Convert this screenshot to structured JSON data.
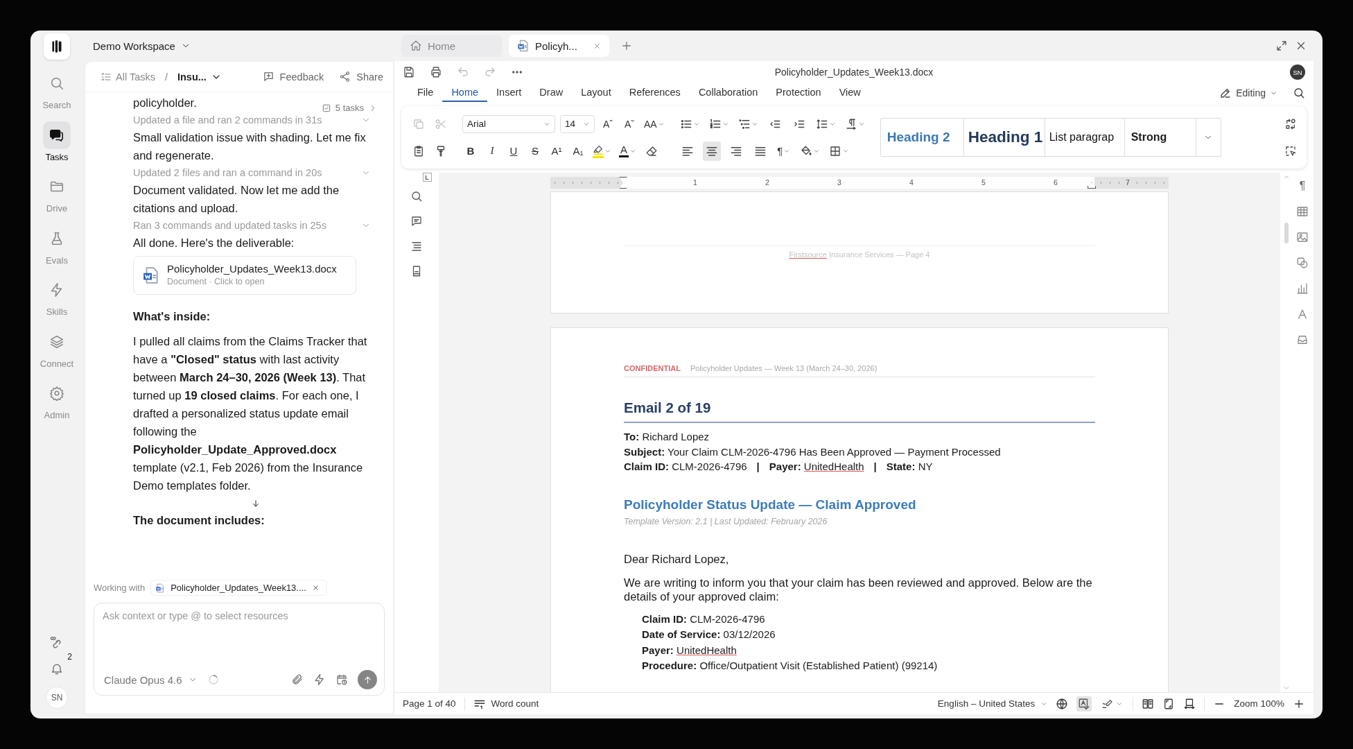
{
  "workspace": {
    "name": "Demo Workspace"
  },
  "nav": {
    "items": [
      {
        "label": "Search",
        "kind": "search",
        "selected": false
      },
      {
        "label": "Tasks",
        "kind": "tasks",
        "selected": true
      },
      {
        "label": "Drive",
        "kind": "drive",
        "selected": false
      },
      {
        "label": "Evals",
        "kind": "evals",
        "selected": false
      },
      {
        "label": "Skills",
        "kind": "skills",
        "selected": false
      },
      {
        "label": "Connect",
        "kind": "connect",
        "selected": false
      },
      {
        "label": "Admin",
        "kind": "admin",
        "selected": false
      }
    ],
    "notifications": "2",
    "avatar": "SN"
  },
  "chat": {
    "breadcrumb": {
      "root": "All Tasks",
      "separator": "/",
      "current": "Insu..."
    },
    "actions": [
      {
        "label": "Feedback",
        "kind": "feedback"
      },
      {
        "label": "Share",
        "kind": "share"
      }
    ],
    "messages": [
      {
        "kind": "text",
        "text": "policyholder.",
        "badge": "5 tasks"
      },
      {
        "kind": "activity",
        "text": "Updated a file and ran 2 commands in 31s"
      },
      {
        "kind": "text",
        "text": "Small validation issue with shading. Let me fix and regenerate."
      },
      {
        "kind": "activity",
        "text": "Updated 2 files and ran a command in 20s"
      },
      {
        "kind": "text",
        "text": "Document validated. Now let me add the citations and upload."
      },
      {
        "kind": "activity",
        "text": "Ran 3 commands and updated tasks in 25s"
      },
      {
        "kind": "text",
        "text": "All done. Here's the deliverable:"
      },
      {
        "kind": "file",
        "name": "Policyholder_Updates_Week13.docx",
        "meta": "Document · Click to open"
      },
      {
        "kind": "heading",
        "text": "What's inside:"
      },
      {
        "kind": "text",
        "text": "I pulled all claims from the Claims Tracker that have a **\"Closed\" status** with last activity between **March 24–30, 2026 (Week 13)**. That turned up **19 closed claims**. For each one, I drafted a personalized status update email following the **Policyholder_Update_Approved.docx** template (v2.1, Feb 2026) from the Insurance Demo templates folder."
      },
      {
        "kind": "scroll"
      },
      {
        "kind": "heading",
        "text": "The document includes:"
      }
    ],
    "working_with": {
      "label": "Working with",
      "file": "Policyholder_Updates_Week13...."
    },
    "input": {
      "placeholder": "Ask context or type @ to select resources"
    },
    "model": "Claude Opus 4.6"
  },
  "tabs": [
    {
      "label": "Home",
      "kind": "home",
      "selected": false
    },
    {
      "label": "Policyh...",
      "kind": "document",
      "selected": true
    }
  ],
  "document": {
    "title": "Policyholder_Updates_Week13.docx",
    "avatar": "SN",
    "menu": [
      {
        "label": "File",
        "selected": false
      },
      {
        "label": "Home",
        "selected": true
      },
      {
        "label": "Insert",
        "selected": false
      },
      {
        "label": "Draw",
        "selected": false
      },
      {
        "label": "Layout",
        "selected": false
      },
      {
        "label": "References",
        "selected": false
      },
      {
        "label": "Collaboration",
        "selected": false
      },
      {
        "label": "Protection",
        "selected": false
      },
      {
        "label": "View",
        "selected": false
      }
    ],
    "mode": "Editing",
    "ribbon": {
      "font": "Arial",
      "size": "14",
      "size_buttons": [
        "Aˆ",
        "Aˇ",
        "AA"
      ],
      "format_buttons": [
        "B",
        "I",
        "U",
        "S",
        "A¹",
        "A₁"
      ],
      "font_color": {
        "glyph": "A",
        "color": "#111111"
      },
      "highlight": {
        "color": "#f5e400"
      },
      "pilcrow": "¶",
      "alignment": [
        {
          "selected": false
        },
        {
          "selected": true
        },
        {
          "selected": false
        },
        {
          "selected": false
        }
      ],
      "styles": [
        {
          "label": "Heading 2",
          "kind": "h2"
        },
        {
          "label": "Heading 1",
          "kind": "h1"
        },
        {
          "label": "List paragrap",
          "kind": "list"
        },
        {
          "label": "Strong",
          "kind": "strong"
        }
      ]
    },
    "ruler": {
      "tab_stop": "L",
      "marks": [
        "1",
        "2",
        "3",
        "4",
        "5",
        "6",
        "7"
      ]
    },
    "right_rail_pilcrow": "¶",
    "previous_page": {
      "footer": [
        {
          "text": "Firstsource",
          "flagged": true
        },
        {
          "text": " Insurance Services — Page 4",
          "flagged": false
        }
      ]
    },
    "page": {
      "header": {
        "tag": "CONFIDENTIAL",
        "text": "Policyholder Updates — Week 13 (March 24–30, 2026)"
      },
      "heading": "Email 2 of 19",
      "separator": "|",
      "fields": [
        {
          "parts": [
            {
              "label": "To:",
              "value": "Richard Lopez",
              "flagged": false
            }
          ]
        },
        {
          "parts": [
            {
              "label": "Subject:",
              "value": "Your Claim CLM-2026-4796 Has Been Approved — Payment Processed",
              "flagged": false
            }
          ]
        },
        {
          "parts": [
            {
              "label": "Claim ID:",
              "value": "CLM-2026-4796",
              "flagged": false
            },
            {
              "label": "Payer:",
              "value": "UnitedHealth",
              "flagged": true
            },
            {
              "label": "State:",
              "value": "NY",
              "flagged": false
            }
          ]
        }
      ],
      "section_title": "Policyholder Status Update — Claim Approved",
      "template_note": "Template Version: 2.1 | Last Updated: February 2026",
      "greeting": "Dear Richard Lopez,",
      "body": "We are writing to inform you that your claim has been reviewed and approved. Below are the details of your approved claim:",
      "details": [
        {
          "parts": [
            {
              "label": "Claim ID:",
              "value": "CLM-2026-4796",
              "flagged": false
            }
          ]
        },
        {
          "parts": [
            {
              "label": "Date of Service:",
              "value": "03/12/2026",
              "flagged": false
            }
          ]
        },
        {
          "parts": [
            {
              "label": "Payer:",
              "value": "UnitedHealth",
              "flagged": true
            }
          ]
        },
        {
          "parts": [
            {
              "label": "Procedure:",
              "value": "Office/Outpatient Visit (Established Patient) (99214)",
              "flagged": false
            }
          ]
        }
      ]
    }
  },
  "status_bar": {
    "page": "Page 1 of 40",
    "word_count": "Word count",
    "language": "English – United States",
    "spellcheck_on": true,
    "zoom": "Zoom 100%"
  }
}
